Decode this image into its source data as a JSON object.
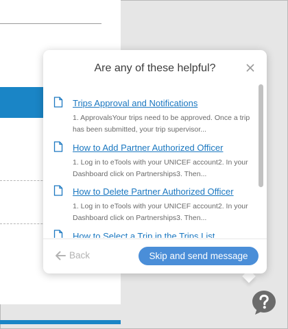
{
  "popup": {
    "title": "Are any of these helpful?",
    "articles": [
      {
        "title": "Trips Approval and Notifications",
        "snippet": "1. ApprovalsYour trips need to be approved. Once a trip has been submitted, your trip supervisor..."
      },
      {
        "title": "How to Add Partner Authorized Officer",
        "snippet": "1. Log in to eTools with your UNICEF account2. In your Dashboard click on Partnerships3. Then..."
      },
      {
        "title": "How to Delete Partner Authorized Officer",
        "snippet": "1. Log in to eTools with your UNICEF account2. In your Dashboard click on Partnerships3. Then..."
      },
      {
        "title": "How to Select a Trip in the Trips List",
        "snippet": ""
      }
    ],
    "back_label": "Back",
    "skip_label": "Skip and send message"
  },
  "icons": {
    "close": "close-icon",
    "article": "document-icon",
    "back": "arrow-left-icon",
    "help": "question-bubble-icon"
  },
  "colors": {
    "accent": "#1a85c6",
    "link": "#1a77c0",
    "button": "#4a8ed8",
    "help_icon": "#6b6b6b"
  }
}
